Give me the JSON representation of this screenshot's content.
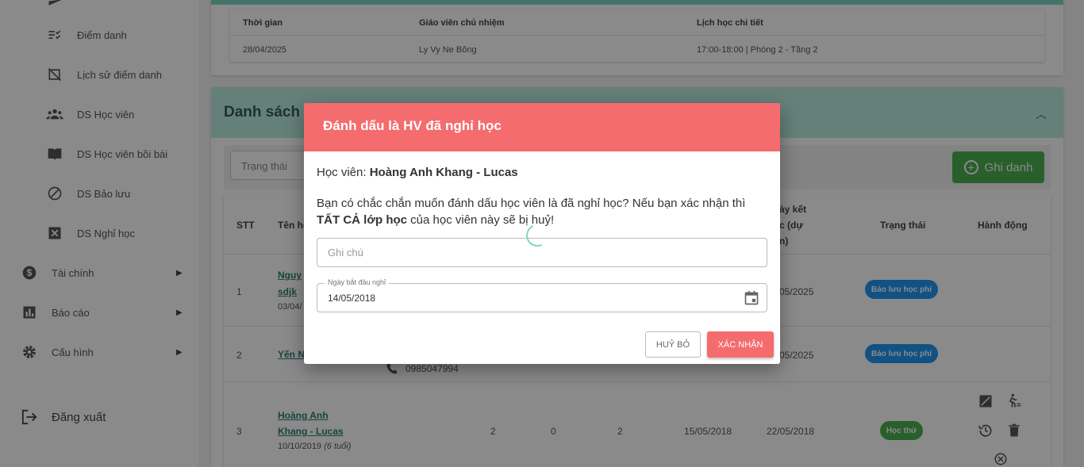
{
  "sidebar": {
    "sub_items": [
      {
        "label": "Điểm danh",
        "icon": "checklist-icon"
      },
      {
        "label": "Lịch sử điểm danh",
        "icon": "history-slash-icon"
      },
      {
        "label": "DS Học viên",
        "icon": "people-icon"
      },
      {
        "label": "DS Học viên bồi bài",
        "icon": "book-icon"
      },
      {
        "label": "DS Bảo lưu",
        "icon": "block-icon"
      },
      {
        "label": "DS Nghỉ học",
        "icon": "x-box-icon"
      }
    ],
    "top_items": [
      {
        "label": "Tài chính",
        "icon": "dollar-icon"
      },
      {
        "label": "Báo cáo",
        "icon": "chart-icon"
      },
      {
        "label": "Cấu hình",
        "icon": "gear-icon"
      }
    ],
    "logout": "Đăng xuất"
  },
  "class_info": {
    "headers": {
      "time": "Thời gian",
      "teacher": "Giáo viên chủ nhiệm",
      "schedule": "Lịch học chi tiết"
    },
    "row": {
      "time": "28/04/2025",
      "teacher": "Ly Vy Ne Bông",
      "schedule": "17:00-18:00 | Phòng 2 - Tầng 2"
    }
  },
  "student_list": {
    "title": "Danh sách h",
    "status_placeholder": "Trạng thái",
    "enroll_label": "Ghi danh",
    "headers": {
      "stt": "STT",
      "name": "Tên họ",
      "end_date_l1": "ày kết",
      "end_date_l2": "c (dự",
      "end_date_l3": "n)",
      "status": "Trạng thái",
      "actions": "Hành động"
    },
    "rows": [
      {
        "stt": "1",
        "name_l1": "Nguy",
        "name_l2": "sdjk",
        "dob": "03/04/",
        "end": "05/2025",
        "badge": "Bảo lưu học phí"
      },
      {
        "stt": "2",
        "name_l1": "Yến N",
        "phone": "0985047994",
        "end": "05/2025",
        "badge": "Bảo lưu học phí"
      },
      {
        "stt": "3",
        "name_l1": "Hoàng Anh",
        "name_l2": "Khang - Lucas",
        "dob": "10/10/2019",
        "age": "(6 tuổi)",
        "c1": "2",
        "c2": "0",
        "c3": "2",
        "start": "15/05/2018",
        "end": "22/05/2018",
        "badge": "Học thử"
      }
    ]
  },
  "dialog": {
    "title": "Đánh dấu là HV đã nghỉ học",
    "student_prefix": "Học viên: ",
    "student_name": "Hoàng Anh Khang - Lucas",
    "message_part1": "Bạn có chắc chắn muốn đánh dấu học viên là đã nghỉ học? Nếu bạn xác nhận thì ",
    "message_bold": "TẤT CẢ lớp học",
    "message_part2": " của học viên này sẽ bị huỷ!",
    "note_placeholder": "Ghi chú",
    "note_value": "",
    "date_label": "Ngày bắt đầu nghỉ",
    "date_value": "14/05/2018",
    "cancel_label": "HUỶ BỎ",
    "confirm_label": "XÁC NHẬN"
  },
  "colors": {
    "accent": "#7fd6c2",
    "danger": "#f46c6e",
    "success": "#4caf50",
    "info": "#2196f3"
  }
}
